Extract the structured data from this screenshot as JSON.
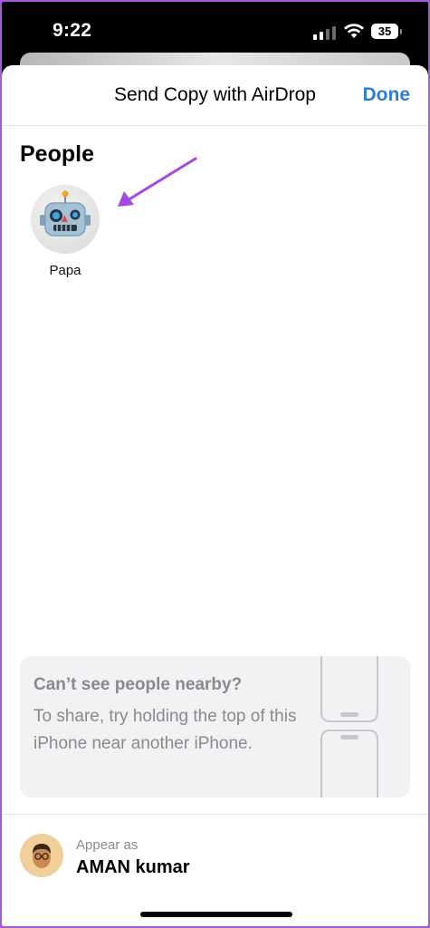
{
  "status_bar": {
    "time": "9:22",
    "battery": "35",
    "signal_bars_active": 2,
    "signal_bars_total": 4
  },
  "sheet": {
    "title": "Send Copy with AirDrop",
    "done_label": "Done",
    "accent_color": "#2d7dd8"
  },
  "people": {
    "heading": "People",
    "items": [
      {
        "name": "Papa",
        "avatar": "robot-memoji-icon"
      }
    ]
  },
  "annotation": {
    "arrow_color": "#a347e6",
    "points_to": "Papa"
  },
  "help": {
    "title": "Can’t see people nearby?",
    "body": "To share, try holding the top of this iPhone near another iPhone."
  },
  "me": {
    "label": "Appear as",
    "name": "AMAN kumar",
    "avatar": "memoji-face-icon"
  }
}
